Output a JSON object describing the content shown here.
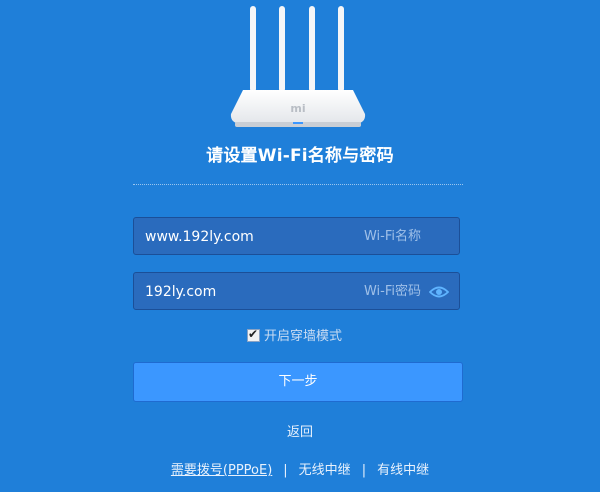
{
  "router": {
    "logo": "mi"
  },
  "page_title": "请设置Wi-Fi名称与密码",
  "wifi_name": {
    "value": "www.192ly.com",
    "label": "Wi-Fi名称"
  },
  "wifi_password": {
    "value": "192ly.com",
    "label": "Wi-Fi密码"
  },
  "wall_mode": {
    "label": "开启穿墙模式",
    "checked": true
  },
  "next_button": {
    "label": "下一步"
  },
  "back_link": "返回",
  "bottom_links": {
    "pppoe": "需要拨号(PPPoE)",
    "separator": "|",
    "wireless_relay": "无线中继",
    "wired_relay": "有线中继"
  },
  "colors": {
    "background": "#1f7fd9",
    "input_background": "#2a6bbd",
    "button": "#3b97ff",
    "eye_icon": "#5fb4ff"
  }
}
